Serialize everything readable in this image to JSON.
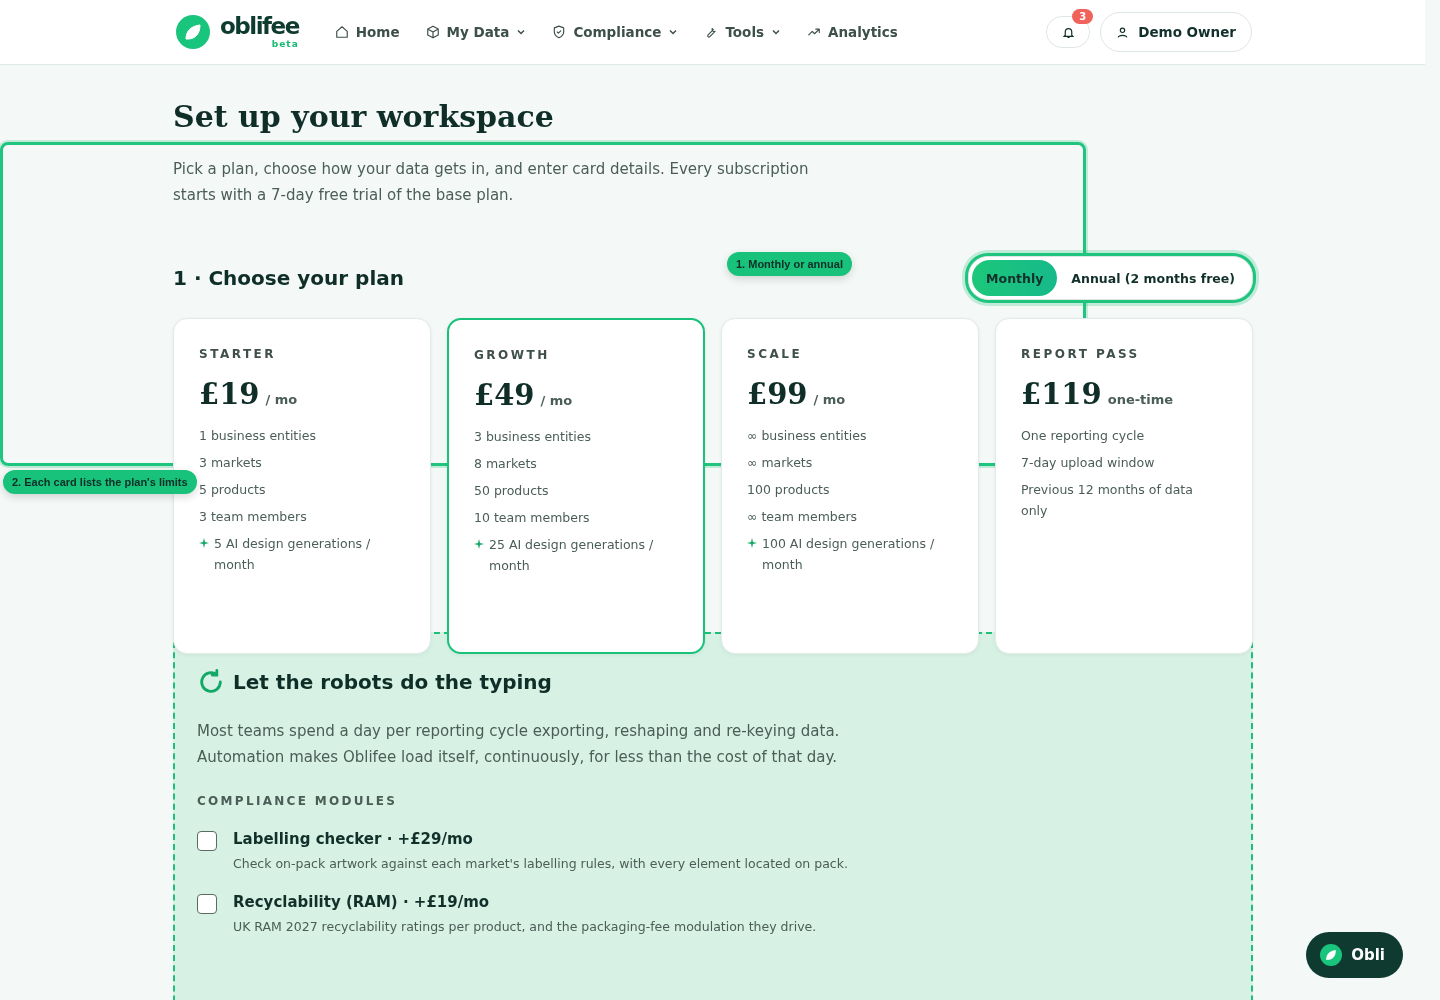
{
  "header": {
    "logo": {
      "name": "oblifee",
      "tag": "beta"
    },
    "nav": [
      {
        "label": "Home",
        "dropdown": false
      },
      {
        "label": "My Data",
        "dropdown": true
      },
      {
        "label": "Compliance",
        "dropdown": true
      },
      {
        "label": "Tools",
        "dropdown": true
      },
      {
        "label": "Analytics",
        "dropdown": false
      }
    ],
    "notifications": {
      "count": "3"
    },
    "user": {
      "name": "Demo Owner"
    }
  },
  "page": {
    "title": "Set up your workspace",
    "intro": "Pick a plan, choose how your data gets in, and enter card details. Every subscription starts with a 7-day free trial of the base plan."
  },
  "plan_section": {
    "heading": "1 · Choose your plan",
    "billing_toggle": [
      {
        "label": "Monthly",
        "selected": true
      },
      {
        "label": "Annual (2 months free)",
        "selected": false
      }
    ],
    "plans": [
      {
        "tier": "STARTER",
        "price": "£19",
        "period": "/ mo",
        "selected": false,
        "features": [
          {
            "text": "1 business entities",
            "ai": false
          },
          {
            "text": "3 markets",
            "ai": false
          },
          {
            "text": "5 products",
            "ai": false
          },
          {
            "text": "3 team members",
            "ai": false
          },
          {
            "text": "5 AI design generations / month",
            "ai": true
          }
        ]
      },
      {
        "tier": "GROWTH",
        "price": "£49",
        "period": "/ mo",
        "selected": true,
        "features": [
          {
            "text": "3 business entities",
            "ai": false
          },
          {
            "text": "8 markets",
            "ai": false
          },
          {
            "text": "50 products",
            "ai": false
          },
          {
            "text": "10 team members",
            "ai": false
          },
          {
            "text": "25 AI design generations / month",
            "ai": true
          }
        ]
      },
      {
        "tier": "SCALE",
        "price": "£99",
        "period": "/ mo",
        "selected": false,
        "features": [
          {
            "text": "∞ business entities",
            "ai": false
          },
          {
            "text": "∞ markets",
            "ai": false
          },
          {
            "text": "100 products",
            "ai": false
          },
          {
            "text": "∞ team members",
            "ai": false
          },
          {
            "text": "100 AI design generations / month",
            "ai": true
          }
        ]
      },
      {
        "tier": "REPORT PASS",
        "price": "£119",
        "period": "one-time",
        "selected": false,
        "features": [
          {
            "text": "One reporting cycle",
            "ai": false
          },
          {
            "text": "7-day upload window",
            "ai": false
          },
          {
            "text": "Previous 12 months of data only",
            "ai": false
          }
        ]
      }
    ]
  },
  "automation": {
    "heading": "Let the robots do the typing",
    "intro": "Most teams spend a day per reporting cycle exporting, reshaping and re-keying data. Automation makes Oblifee load itself, continuously, for less than the cost of that day.",
    "modules_label": "COMPLIANCE MODULES",
    "modules": [
      {
        "title": "Labelling checker · +£29/mo",
        "description": "Check on-pack artwork against each market's labelling rules, with every element located on pack.",
        "checked": false
      },
      {
        "title": "Recyclability (RAM) · +£19/mo",
        "description": "UK RAM 2027 recyclability ratings per product, and the packaging-fee modulation they drive.",
        "checked": false
      }
    ]
  },
  "tour": {
    "steps": [
      {
        "label": "1. Monthly or annual"
      },
      {
        "label": "2. Each card lists the plan's limits"
      }
    ]
  },
  "assistant": {
    "label": "Obli"
  }
}
